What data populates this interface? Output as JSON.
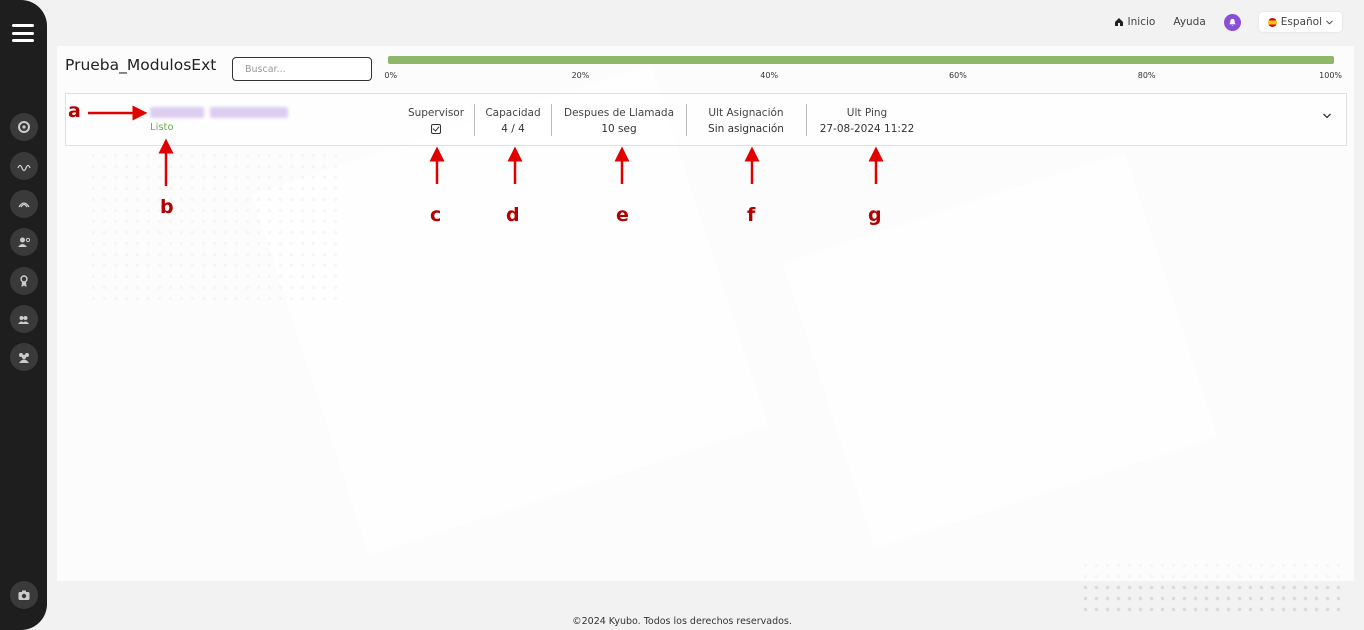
{
  "header": {
    "home_label": "Inicio",
    "help_label": "Ayuda",
    "language_label": "Español"
  },
  "page": {
    "title": "Prueba_ModulosExt",
    "search_placeholder": "Buscar..."
  },
  "progress": {
    "value_percent": 100,
    "ticks": [
      "0%",
      "20%",
      "40%",
      "60%",
      "80%",
      "100%"
    ]
  },
  "agent": {
    "status": "Listo",
    "supervisor_label": "Supervisor",
    "supervisor_checked": true,
    "capacity_label": "Capacidad",
    "capacity_value": "4 / 4",
    "after_call_label": "Despues de Llamada",
    "after_call_value": "10 seg",
    "last_assign_label": "Ult Asignación",
    "last_assign_value": "Sin asignación",
    "last_ping_label": "Ult Ping",
    "last_ping_value": "27-08-2024 11:22"
  },
  "annotations": [
    "a",
    "b",
    "c",
    "d",
    "e",
    "f",
    "g"
  ],
  "footer": {
    "copyright": "©2024 Kyubo. Todos los derechos reservados."
  },
  "colors": {
    "accent_purple": "#8a4fd6",
    "status_green": "#6ab04c",
    "progress_green": "#8fb76a",
    "annotation_red": "#e00000"
  },
  "icons": {
    "sidebar": [
      "menu-icon",
      "target-icon",
      "wave-icon",
      "signal-icon",
      "user-settings-icon",
      "badge-icon",
      "users-settings-icon",
      "group-icon",
      "camera-icon"
    ]
  }
}
